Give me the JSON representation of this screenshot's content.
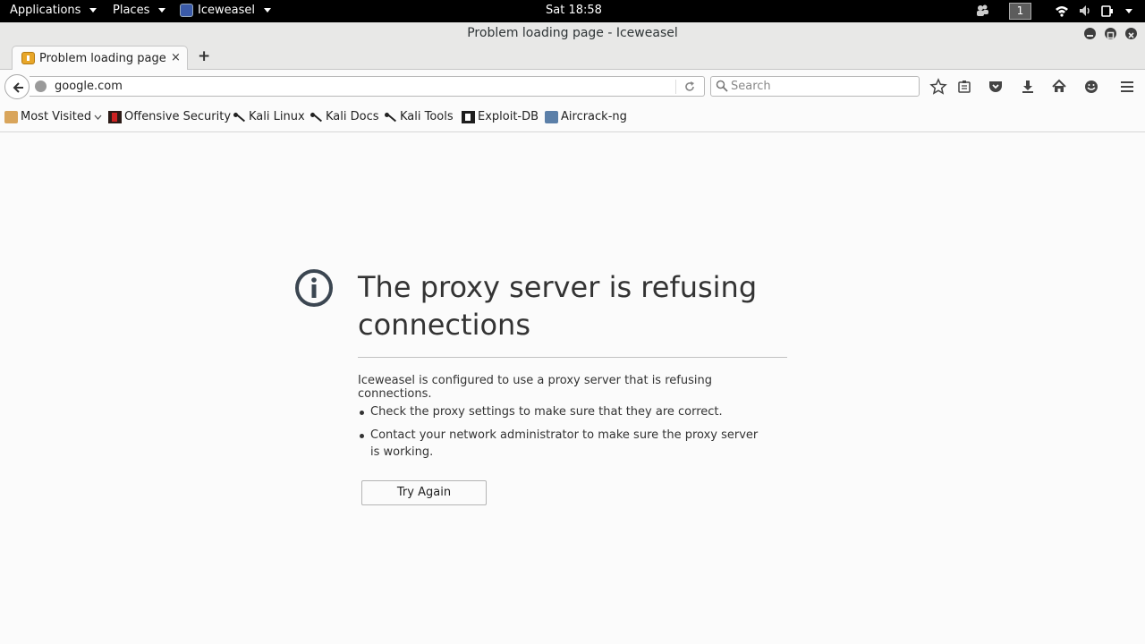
{
  "topbar": {
    "applications": "Applications",
    "places": "Places",
    "app_name": "Iceweasel",
    "clock": "Sat 18:58",
    "workspace": "1"
  },
  "window": {
    "title": "Problem loading page - Iceweasel"
  },
  "tabs": [
    {
      "label": "Problem loading page",
      "close": "×"
    }
  ],
  "newtab": "+",
  "navbar": {
    "url": "google.com",
    "search_placeholder": "Search"
  },
  "bookmarks": [
    {
      "label": "Most Visited",
      "icon": "folder-icon"
    },
    {
      "label": "Offensive Security",
      "icon": "offsec-icon"
    },
    {
      "label": "Kali Linux",
      "icon": "kali-icon"
    },
    {
      "label": "Kali Docs",
      "icon": "kali-icon"
    },
    {
      "label": "Kali Tools",
      "icon": "kali-icon"
    },
    {
      "label": "Exploit-DB",
      "icon": "exploitdb-icon"
    },
    {
      "label": "Aircrack-ng",
      "icon": "aircrack-icon"
    }
  ],
  "error": {
    "title": "The proxy server is refusing connections",
    "description": "Iceweasel is configured to use a proxy server that is refusing connections.",
    "suggestions": [
      "Check the proxy settings to make sure that they are correct.",
      "Contact your network administrator to make sure the proxy server is working."
    ],
    "button": "Try Again"
  },
  "colors": {
    "topbar_bg": "#000000",
    "chrome_bg": "#e8e8e7",
    "page_bg": "#fbfbfb",
    "text": "#333333"
  }
}
